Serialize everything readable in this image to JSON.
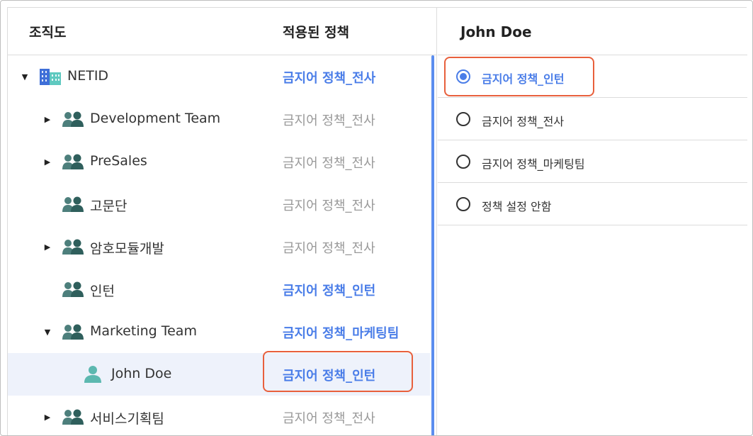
{
  "colors": {
    "accent": "#4a7de8",
    "highlight_border": "#e8603c",
    "inherited_text": "#999999",
    "selected_row_bg": "#eef2fb"
  },
  "tree_panel": {
    "header_org": "조직도",
    "header_policy": "적용된 정책",
    "rows": [
      {
        "label": "NETID",
        "icon": "building-icon",
        "policy": "금지어 정책_전사",
        "applied": true,
        "expander": "expanded"
      },
      {
        "label": "Development Team",
        "icon": "group-icon",
        "policy": "금지어 정책_전사",
        "applied": false,
        "expander": "collapsed"
      },
      {
        "label": "PreSales",
        "icon": "group-icon",
        "policy": "금지어 정책_전사",
        "applied": false,
        "expander": "collapsed"
      },
      {
        "label": "고문단",
        "icon": "group-icon",
        "policy": "금지어 정책_전사",
        "applied": false,
        "expander": "none"
      },
      {
        "label": "암호모듈개발",
        "icon": "group-icon",
        "policy": "금지어 정책_전사",
        "applied": false,
        "expander": "collapsed"
      },
      {
        "label": "인턴",
        "icon": "group-icon",
        "policy": "금지어 정책_인턴",
        "applied": true,
        "expander": "none"
      },
      {
        "label": "Marketing Team",
        "icon": "group-icon",
        "policy": "금지어 정책_마케팅팀",
        "applied": true,
        "expander": "expanded"
      },
      {
        "label": "John Doe",
        "icon": "user-icon",
        "policy": "금지어 정책_인턴",
        "applied": true,
        "expander": "none",
        "selected": true
      },
      {
        "label": "서비스기획팀",
        "icon": "group-icon",
        "policy": "금지어 정책_전사",
        "applied": false,
        "expander": "collapsed"
      }
    ]
  },
  "detail_panel": {
    "title": "John Doe",
    "options": [
      {
        "label": "금지어 정책_인턴",
        "checked": true
      },
      {
        "label": "금지어 정책_전사",
        "checked": false
      },
      {
        "label": "금지어 정책_마케팅팀",
        "checked": false
      },
      {
        "label": "정책 설정 안함",
        "checked": false
      }
    ]
  }
}
